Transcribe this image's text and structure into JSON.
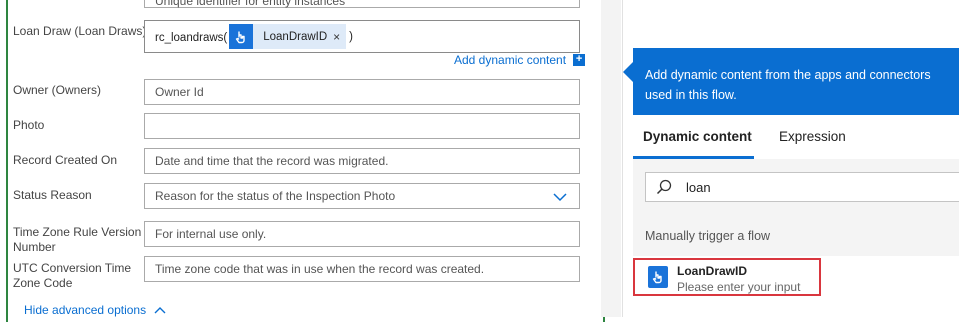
{
  "form": {
    "top_field_partial": "Unique identifier for entity instances",
    "loan_draw": {
      "label": "Loan Draw (Loan Draws)",
      "prefix": "rc_loandraws(",
      "token_label": "LoanDrawID",
      "token_remove": "×",
      "suffix": ")"
    },
    "add_dynamic_content_label": "Add dynamic content",
    "add_dynamic_content_icon": "+",
    "owner": {
      "label": "Owner (Owners)",
      "placeholder": "Owner Id"
    },
    "photo": {
      "label": "Photo",
      "placeholder": ""
    },
    "record_created_on": {
      "label": "Record Created On",
      "placeholder": "Date and time that the record was migrated."
    },
    "status_reason": {
      "label": "Status Reason",
      "placeholder": "Reason for the status of the Inspection Photo"
    },
    "time_zone_rule": {
      "label_line1": "Time Zone Rule Version",
      "label_line2": "Number",
      "placeholder": "For internal use only."
    },
    "utc_conversion": {
      "label_line1": "UTC Conversion Time",
      "label_line2": "Zone Code",
      "placeholder": "Time zone code that was in use when the record was created."
    },
    "hide_advanced_label": "Hide advanced options"
  },
  "dynamic_panel": {
    "header_text": "Add dynamic content from the apps and connectors used in this flow.",
    "tabs": [
      "Dynamic content",
      "Expression"
    ],
    "search_value": "loan",
    "section_title": "Manually trigger a flow",
    "item": {
      "title": "LoanDrawID",
      "subtitle": "Please enter your input"
    }
  },
  "colors": {
    "accent": "#0a6ed1",
    "card_border": "#2e8540",
    "highlight_box": "#d9363e"
  }
}
